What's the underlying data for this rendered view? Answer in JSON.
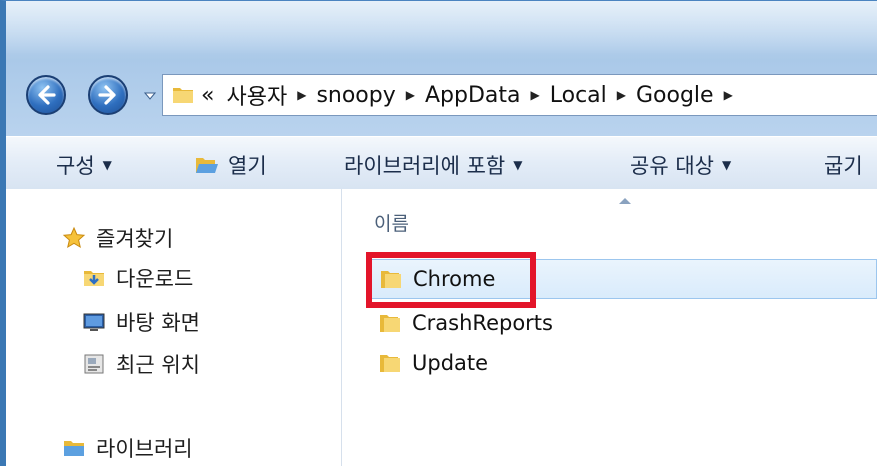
{
  "address_bar": {
    "overflow_marker": "«",
    "path": [
      "사용자",
      "snoopy",
      "AppData",
      "Local",
      "Google"
    ]
  },
  "toolbar": {
    "organize": "구성",
    "open": "열기",
    "include_in_library": "라이브러리에 포함",
    "share_with": "공유 대상",
    "burn_partial": "굽기"
  },
  "nav_pane": {
    "favorites": "즐겨찾기",
    "downloads": "다운로드",
    "desktop": "바탕 화면",
    "recent_places": "최근 위치",
    "libraries": "라이브러리"
  },
  "content": {
    "column_name": "이름",
    "items": [
      {
        "name": "Chrome",
        "selected": true
      },
      {
        "name": "CrashReports",
        "selected": false
      },
      {
        "name": "Update",
        "selected": false
      }
    ]
  },
  "colors": {
    "highlight": "#e3152a",
    "selection": "#d9ebfb",
    "folder": "#f2c94c"
  }
}
